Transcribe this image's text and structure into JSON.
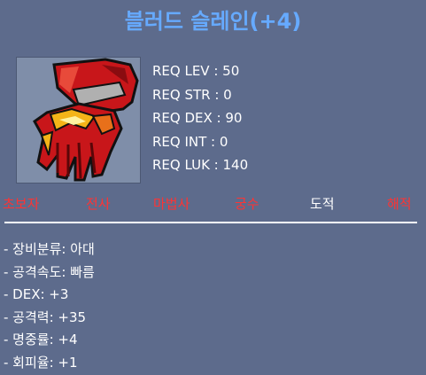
{
  "item": {
    "name": "블러드 슬레인(+4)",
    "icon": "red-glove-icon"
  },
  "requirements": [
    "REQ LEV : 50",
    "REQ STR : 0",
    "REQ DEX : 90",
    "REQ INT : 0",
    "REQ LUK : 140"
  ],
  "jobs": [
    {
      "label": "초보자",
      "enabled": false
    },
    {
      "label": "전사",
      "enabled": false
    },
    {
      "label": "마법사",
      "enabled": false
    },
    {
      "label": "궁수",
      "enabled": false
    },
    {
      "label": "도적",
      "enabled": true
    },
    {
      "label": "해적",
      "enabled": false
    }
  ],
  "stats": [
    "- 장비분류: 아대",
    "- 공격속도: 빠름",
    "- DEX: +3",
    "- 공격력: +35",
    "- 명중률: +4",
    "- 회피율: +1"
  ],
  "colors": {
    "background": "#5d6b8c",
    "title": "#66aaff",
    "job_disabled": "#ff3333",
    "job_enabled": "#ffffff"
  }
}
